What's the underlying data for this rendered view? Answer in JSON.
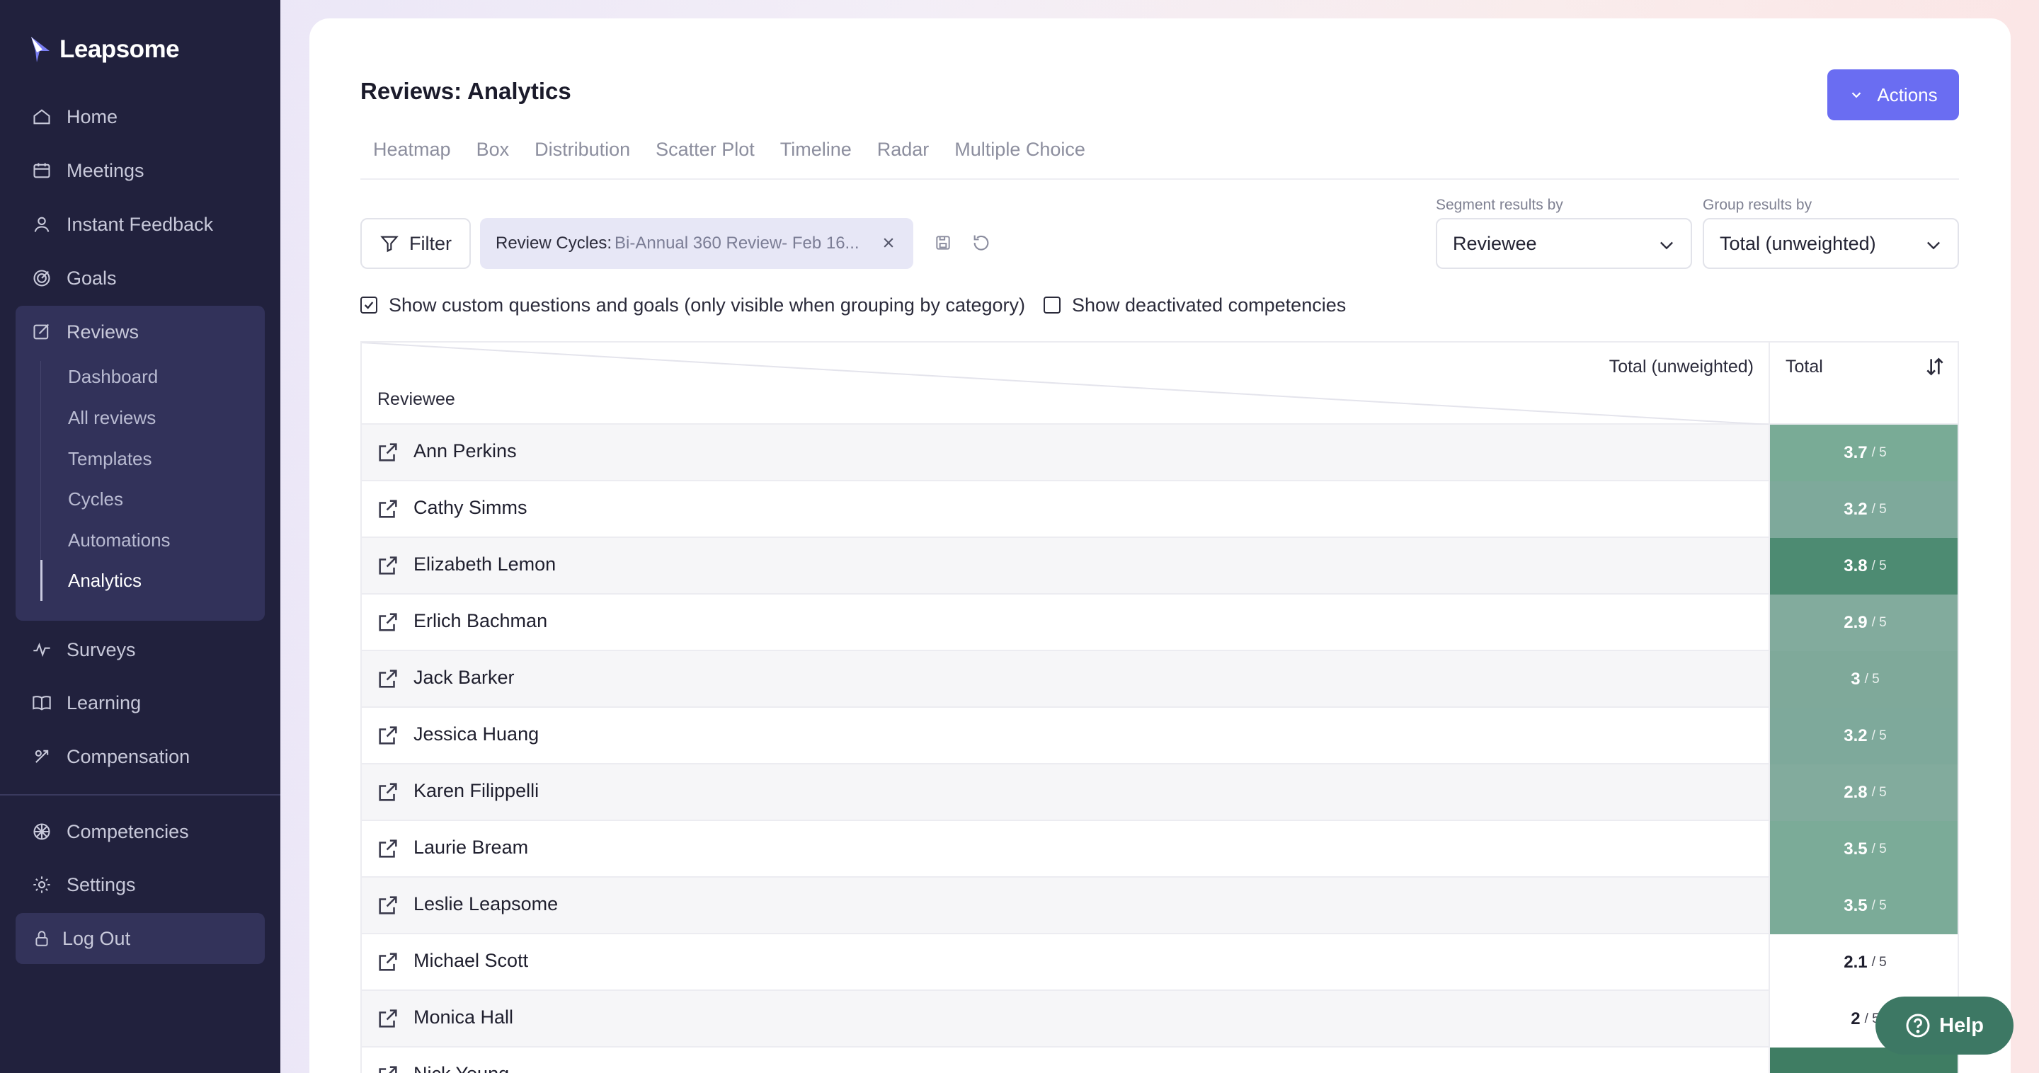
{
  "app": {
    "brand": "Leapsome"
  },
  "sidebar": {
    "items": [
      {
        "label": "Home",
        "icon": "home-icon"
      },
      {
        "label": "Meetings",
        "icon": "meetings-icon"
      },
      {
        "label": "Instant Feedback",
        "icon": "feedback-icon"
      },
      {
        "label": "Goals",
        "icon": "goals-icon"
      },
      {
        "label": "Reviews",
        "icon": "reviews-icon"
      },
      {
        "label": "Surveys",
        "icon": "surveys-icon"
      },
      {
        "label": "Learning",
        "icon": "learning-icon"
      },
      {
        "label": "Compensation",
        "icon": "compensation-icon"
      },
      {
        "label": "Competencies",
        "icon": "competencies-icon"
      },
      {
        "label": "Settings",
        "icon": "settings-icon"
      }
    ],
    "reviews_sub": [
      "Dashboard",
      "All reviews",
      "Templates",
      "Cycles",
      "Automations",
      "Analytics"
    ],
    "active_sub": "Analytics",
    "logout": "Log Out"
  },
  "page": {
    "title": "Reviews: Analytics",
    "actions_label": "Actions",
    "tabs": [
      "Heatmap",
      "Box",
      "Distribution",
      "Scatter Plot",
      "Timeline",
      "Radar",
      "Multiple Choice"
    ]
  },
  "filters": {
    "filter_label": "Filter",
    "chip_key": "Review Cycles:",
    "chip_value": "Bi-Annual 360 Review- Feb 16...",
    "segment_label": "Segment results by",
    "segment_value": "Reviewee",
    "group_label": "Group results by",
    "group_value": "Total (unweighted)",
    "check_custom": "Show custom questions and goals (only visible when grouping by category)",
    "check_custom_checked": true,
    "check_deactivated": "Show deactivated competencies",
    "check_deactivated_checked": false
  },
  "table": {
    "header_group": "Total (unweighted)",
    "header_row": "Reviewee",
    "header_total": "Total",
    "scale_suffix": "/ 5",
    "rows": [
      {
        "name": "Ann Perkins",
        "score": "3.7",
        "color": "#79ab96"
      },
      {
        "name": "Cathy Simms",
        "score": "3.2",
        "color": "#7ea99b"
      },
      {
        "name": "Elizabeth Lemon",
        "score": "3.8",
        "color": "#4d8b72"
      },
      {
        "name": "Erlich Bachman",
        "score": "2.9",
        "color": "#82ab9d"
      },
      {
        "name": "Jack Barker",
        "score": "3",
        "color": "#7fa99a"
      },
      {
        "name": "Jessica Huang",
        "score": "3.2",
        "color": "#7ea99b"
      },
      {
        "name": "Karen Filippelli",
        "score": "2.8",
        "color": "#82ab9d"
      },
      {
        "name": "Laurie Bream",
        "score": "3.5",
        "color": "#7bab98"
      },
      {
        "name": "Leslie Leapsome",
        "score": "3.5",
        "color": "#7bab98"
      },
      {
        "name": "Michael Scott",
        "score": "2.1",
        "color": "#ffffff"
      },
      {
        "name": "Monica Hall",
        "score": "2",
        "color": "#ffffff"
      },
      {
        "name": "Nick Young",
        "score": "",
        "color": "#3f7d63"
      }
    ]
  },
  "help": {
    "label": "Help"
  }
}
